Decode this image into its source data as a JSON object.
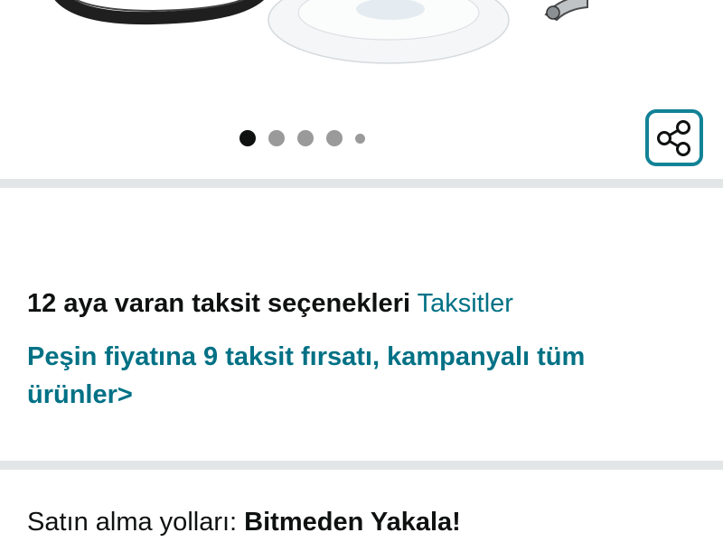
{
  "carousel": {
    "dot_count": 5,
    "active_index": 0,
    "share_icon": "share-icon"
  },
  "installment": {
    "label": "12 aya varan taksit seçenekleri",
    "link": "Taksitler",
    "promo": "Peşin fiyatına 9 taksit fırsatı, kampanyalı tüm ürünler>"
  },
  "purchase": {
    "label": "Satın alma yolları:",
    "value": "Bitmeden Yakala!"
  },
  "colors": {
    "link": "#007185",
    "share_border": "#128296",
    "divider": "#e3e6e6",
    "dot_active": "#0f1111",
    "dot_inactive": "#9a9a9a"
  }
}
